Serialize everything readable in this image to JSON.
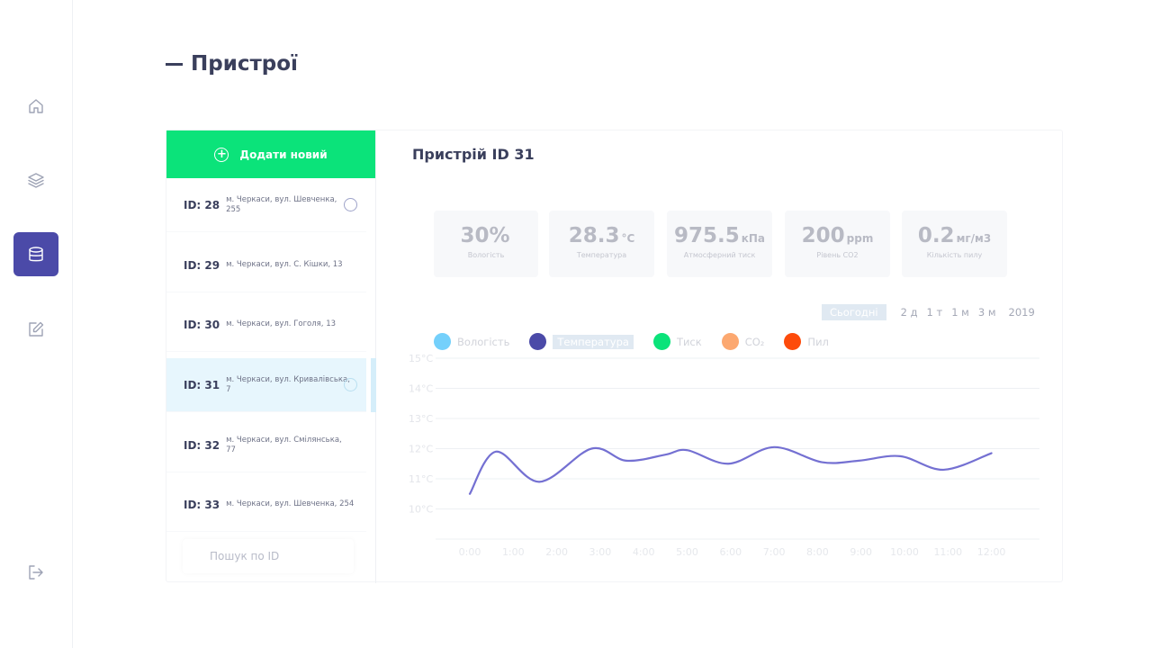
{
  "header": {
    "title": "Пристрої"
  },
  "sidebar": {
    "items": [
      {
        "icon": "home-icon"
      },
      {
        "icon": "layers-icon"
      },
      {
        "icon": "database-icon",
        "active": true
      },
      {
        "icon": "edit-icon"
      },
      {
        "icon": "logout-icon"
      }
    ]
  },
  "devices": {
    "add_label": "Додати новий",
    "search_placeholder": "Пошук по ID",
    "items": [
      {
        "id": "ID: 28",
        "address": "м. Черкаси, вул. Шевченка, 255"
      },
      {
        "id": "ID: 29",
        "address": "м. Черкаси, вул. С. Кішки, 13"
      },
      {
        "id": "ID: 30",
        "address": "м. Черкаси, вул. Гоголя, 13"
      },
      {
        "id": "ID: 31",
        "address": "м. Черкаси, вул. Кривалівська, 7",
        "selected": true
      },
      {
        "id": "ID: 32",
        "address": "м. Черкаси, вул. Смілянська, 77"
      },
      {
        "id": "ID: 33",
        "address": "м. Черкаси, вул. Шевченка, 254"
      }
    ]
  },
  "detail": {
    "title": "Пристрій ID 31",
    "stats": [
      {
        "value": "30%",
        "unit": "",
        "label": "Вологість"
      },
      {
        "value": "28.3",
        "unit": "°C",
        "label": "Температура"
      },
      {
        "value": "975.5",
        "unit": "кПа",
        "label": "Атмосферний тиск"
      },
      {
        "value": "200",
        "unit": "ppm",
        "label": "Рівень CO2"
      },
      {
        "value": "0.2",
        "unit": "мг/м3",
        "label": "Кількість пилу"
      }
    ],
    "ranges": [
      "Сьогодні",
      "2 д",
      "1 т",
      "1 м",
      "3 м",
      "2019"
    ],
    "legend": [
      {
        "label": "Вологість",
        "color": "#74d0fb"
      },
      {
        "label": "Температура",
        "color": "#4b4aa8",
        "active": true
      },
      {
        "label": "Тиск",
        "color": "#0be37a"
      },
      {
        "label": "CO₂",
        "color": "#fca870"
      },
      {
        "label": "Пил",
        "color": "#fd4b0b"
      }
    ]
  },
  "chart_data": {
    "type": "line",
    "x": [
      "0:00",
      "1:00",
      "2:00",
      "3:00",
      "4:00",
      "5:00",
      "6:00",
      "7:00",
      "8:00",
      "9:00",
      "10:00",
      "11:00",
      "12:00"
    ],
    "y_ticks": [
      "15°C",
      "14°C",
      "13°C",
      "12°C",
      "11°C",
      "10°C"
    ],
    "ylim": [
      9,
      15
    ],
    "series": [
      {
        "name": "Температура",
        "color": "#7470d2",
        "values": [
          10.5,
          11.9,
          10.9,
          12.0,
          11.6,
          11.8,
          11.95,
          11.5,
          12.05,
          11.55,
          11.6,
          11.75,
          11.3,
          11.85
        ]
      }
    ],
    "x_points": [
      0,
      0.6,
      1.6,
      2.8,
      3.6,
      4.5,
      5.0,
      5.95,
      7.0,
      8.1,
      8.95,
      9.9,
      10.9,
      12.0
    ],
    "grid": true
  }
}
